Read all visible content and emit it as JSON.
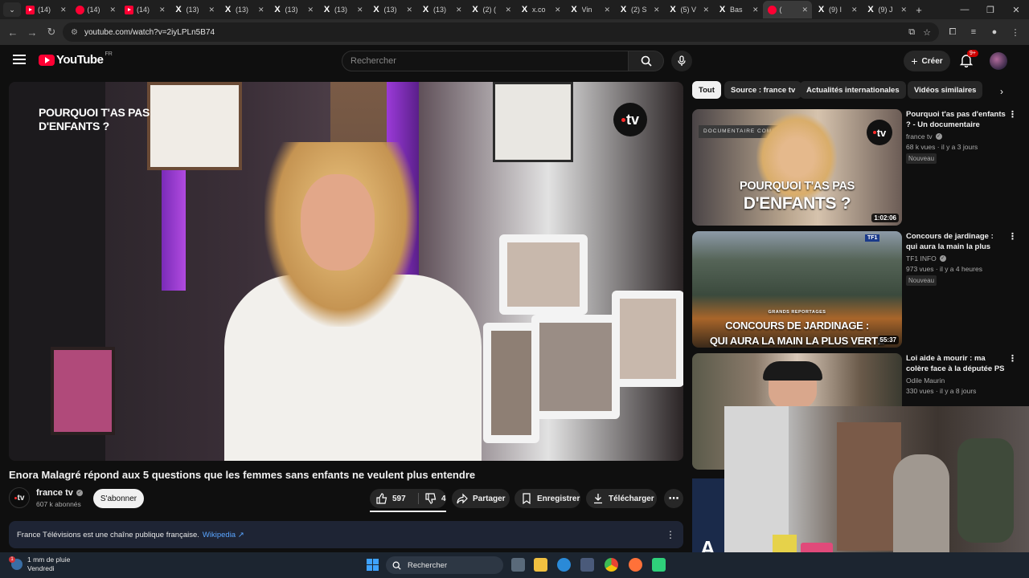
{
  "browser": {
    "tabs": [
      {
        "label": "(14)",
        "icon": "youtube-icon",
        "active": false
      },
      {
        "label": "(14)",
        "icon": "youtube-icon",
        "active": false
      },
      {
        "label": "(14)",
        "icon": "youtube-icon",
        "active": false
      },
      {
        "label": "(13)",
        "icon": "x-icon",
        "active": false
      },
      {
        "label": "(13)",
        "icon": "x-icon",
        "active": false
      },
      {
        "label": "(13)",
        "icon": "x-icon",
        "active": false
      },
      {
        "label": "(13)",
        "icon": "x-icon",
        "active": false
      },
      {
        "label": "(13)",
        "icon": "x-icon",
        "active": false
      },
      {
        "label": "(13)",
        "icon": "x-icon",
        "active": false
      },
      {
        "label": "(2) (",
        "icon": "x-icon",
        "active": false
      },
      {
        "label": "x.co",
        "icon": "x-icon",
        "active": false
      },
      {
        "label": "Vin",
        "icon": "x-icon",
        "active": false
      },
      {
        "label": "(2) S",
        "icon": "x-icon",
        "active": false
      },
      {
        "label": "(5) V",
        "icon": "x-icon",
        "active": false
      },
      {
        "label": "Bas",
        "icon": "x-icon",
        "active": false
      },
      {
        "label": "(",
        "icon": "youtube-icon",
        "active": true
      },
      {
        "label": "(9) I",
        "icon": "x-icon",
        "active": false
      },
      {
        "label": "(9) J",
        "icon": "x-icon",
        "active": false
      }
    ],
    "url": "youtube.com/watch?v=2iyLPLn5B74"
  },
  "header": {
    "logo_text": "YouTube",
    "country_code": "FR",
    "search_placeholder": "Rechercher",
    "create_label": "Créer",
    "notifications_badge": "9+"
  },
  "video": {
    "overlay_title_line1": "POURQUOI T'AS PAS",
    "overlay_title_line2": "D'ENFANTS ?",
    "watermark": "tv",
    "title": "Enora Malagré répond aux 5 questions que les femmes sans enfants ne veulent plus entendre",
    "channel": {
      "name": "france tv",
      "subscribers": "607 k abonnés",
      "avatar_text": "tv"
    },
    "subscribe_label": "S'abonner",
    "likes": "597",
    "dislikes": "4",
    "share_label": "Partager",
    "save_label": "Enregistrer",
    "download_label": "Télécharger",
    "info_text": "France Télévisions est une chaîne publique française.",
    "info_link": "Wikipedia"
  },
  "chips": [
    "Tout",
    "Source : france tv",
    "Actualités internationales",
    "Vidéos similaires"
  ],
  "recommendations": [
    {
      "title": "Pourquoi t'as pas d'enfants ? - Un documentaire d'Énor...",
      "channel": "france tv",
      "meta": "68 k vues · il y a 3 jours",
      "badge": "Nouveau",
      "duration": "1:02:06",
      "thumb_tag": "DOCUMENTAIRE COMPLET",
      "thumb_text_line1": "POURQUOI T'AS PAS",
      "thumb_text_line2": "D'ENFANTS ?"
    },
    {
      "title": "Concours de jardinage : qui aura la main la plus verte ?...",
      "channel": "TF1 INFO",
      "meta": "973 vues · il y a 4 heures",
      "badge": "Nouveau",
      "duration": "55:37",
      "thumb_tag": "GRANDS REPORTAGES",
      "thumb_text_line1": "CONCOURS DE JARDINAGE :",
      "thumb_text_line2": "QUI AURA LA MAIN LA PLUS VERTE"
    },
    {
      "title": "Loi aide à mourir : ma colère face à la députée PS qui ...",
      "channel": "Odile Maurin",
      "meta": "330 vues · il y a 8 jours",
      "badge": "",
      "duration": "",
      "thumb_tag": "",
      "thumb_text_line1": "",
      "thumb_text_line2": ""
    }
  ],
  "taskbar": {
    "weather_line1": "1 mm de pluie",
    "weather_line2": "Vendredi",
    "search_label": "Rechercher"
  },
  "colors": {
    "background": "#0f0f0f",
    "accent": "#ff0033",
    "link": "#5aa5ff"
  }
}
